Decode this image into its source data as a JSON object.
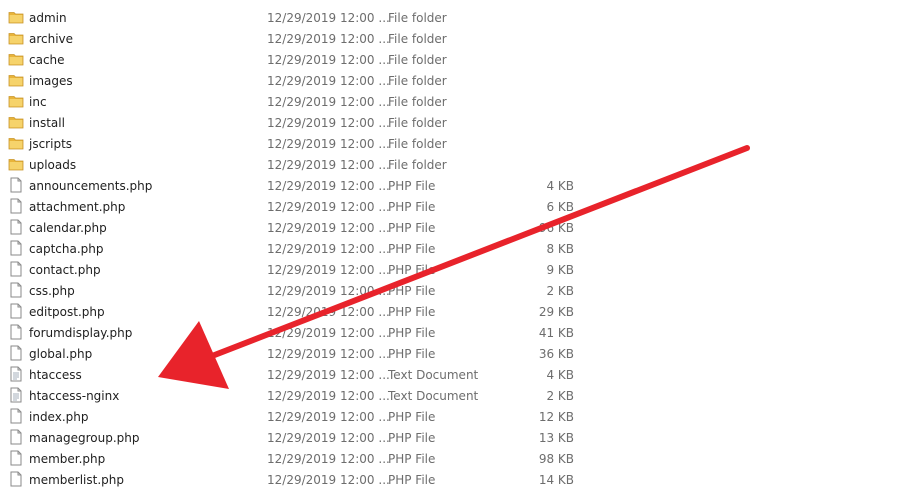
{
  "accent": {
    "arrow_color": "#e8232b",
    "folder_color": "#e8b43a"
  },
  "files": [
    {
      "name": "admin",
      "date": "12/29/2019 12:00 ...",
      "type": "File folder",
      "size": "",
      "icon": "folder-icon"
    },
    {
      "name": "archive",
      "date": "12/29/2019 12:00 ...",
      "type": "File folder",
      "size": "",
      "icon": "folder-icon"
    },
    {
      "name": "cache",
      "date": "12/29/2019 12:00 ...",
      "type": "File folder",
      "size": "",
      "icon": "folder-icon"
    },
    {
      "name": "images",
      "date": "12/29/2019 12:00 ...",
      "type": "File folder",
      "size": "",
      "icon": "folder-icon"
    },
    {
      "name": "inc",
      "date": "12/29/2019 12:00 ...",
      "type": "File folder",
      "size": "",
      "icon": "folder-icon"
    },
    {
      "name": "install",
      "date": "12/29/2019 12:00 ...",
      "type": "File folder",
      "size": "",
      "icon": "folder-icon"
    },
    {
      "name": "jscripts",
      "date": "12/29/2019 12:00 ...",
      "type": "File folder",
      "size": "",
      "icon": "folder-icon"
    },
    {
      "name": "uploads",
      "date": "12/29/2019 12:00 ...",
      "type": "File folder",
      "size": "",
      "icon": "folder-icon"
    },
    {
      "name": "announcements.php",
      "date": "12/29/2019 12:00 ...",
      "type": "PHP File",
      "size": "4 KB",
      "icon": "file-icon"
    },
    {
      "name": "attachment.php",
      "date": "12/29/2019 12:00 ...",
      "type": "PHP File",
      "size": "6 KB",
      "icon": "file-icon"
    },
    {
      "name": "calendar.php",
      "date": "12/29/2019 12:00 ...",
      "type": "PHP File",
      "size": "96 KB",
      "icon": "file-icon"
    },
    {
      "name": "captcha.php",
      "date": "12/29/2019 12:00 ...",
      "type": "PHP File",
      "size": "8 KB",
      "icon": "file-icon"
    },
    {
      "name": "contact.php",
      "date": "12/29/2019 12:00 ...",
      "type": "PHP File",
      "size": "9 KB",
      "icon": "file-icon"
    },
    {
      "name": "css.php",
      "date": "12/29/2019 12:00 ...",
      "type": "PHP File",
      "size": "2 KB",
      "icon": "file-icon"
    },
    {
      "name": "editpost.php",
      "date": "12/29/2019 12:00 ...",
      "type": "PHP File",
      "size": "29 KB",
      "icon": "file-icon"
    },
    {
      "name": "forumdisplay.php",
      "date": "12/29/2019 12:00 ...",
      "type": "PHP File",
      "size": "41 KB",
      "icon": "file-icon"
    },
    {
      "name": "global.php",
      "date": "12/29/2019 12:00 ...",
      "type": "PHP File",
      "size": "36 KB",
      "icon": "file-icon"
    },
    {
      "name": "htaccess",
      "date": "12/29/2019 12:00 ...",
      "type": "Text Document",
      "size": "4 KB",
      "icon": "text-document-icon"
    },
    {
      "name": "htaccess-nginx",
      "date": "12/29/2019 12:00 ...",
      "type": "Text Document",
      "size": "2 KB",
      "icon": "text-document-icon"
    },
    {
      "name": "index.php",
      "date": "12/29/2019 12:00 ...",
      "type": "PHP File",
      "size": "12 KB",
      "icon": "file-icon"
    },
    {
      "name": "managegroup.php",
      "date": "12/29/2019 12:00 ...",
      "type": "PHP File",
      "size": "13 KB",
      "icon": "file-icon"
    },
    {
      "name": "member.php",
      "date": "12/29/2019 12:00 ...",
      "type": "PHP File",
      "size": "98 KB",
      "icon": "file-icon"
    },
    {
      "name": "memberlist.php",
      "date": "12/29/2019 12:00 ...",
      "type": "PHP File",
      "size": "14 KB",
      "icon": "file-icon"
    }
  ]
}
